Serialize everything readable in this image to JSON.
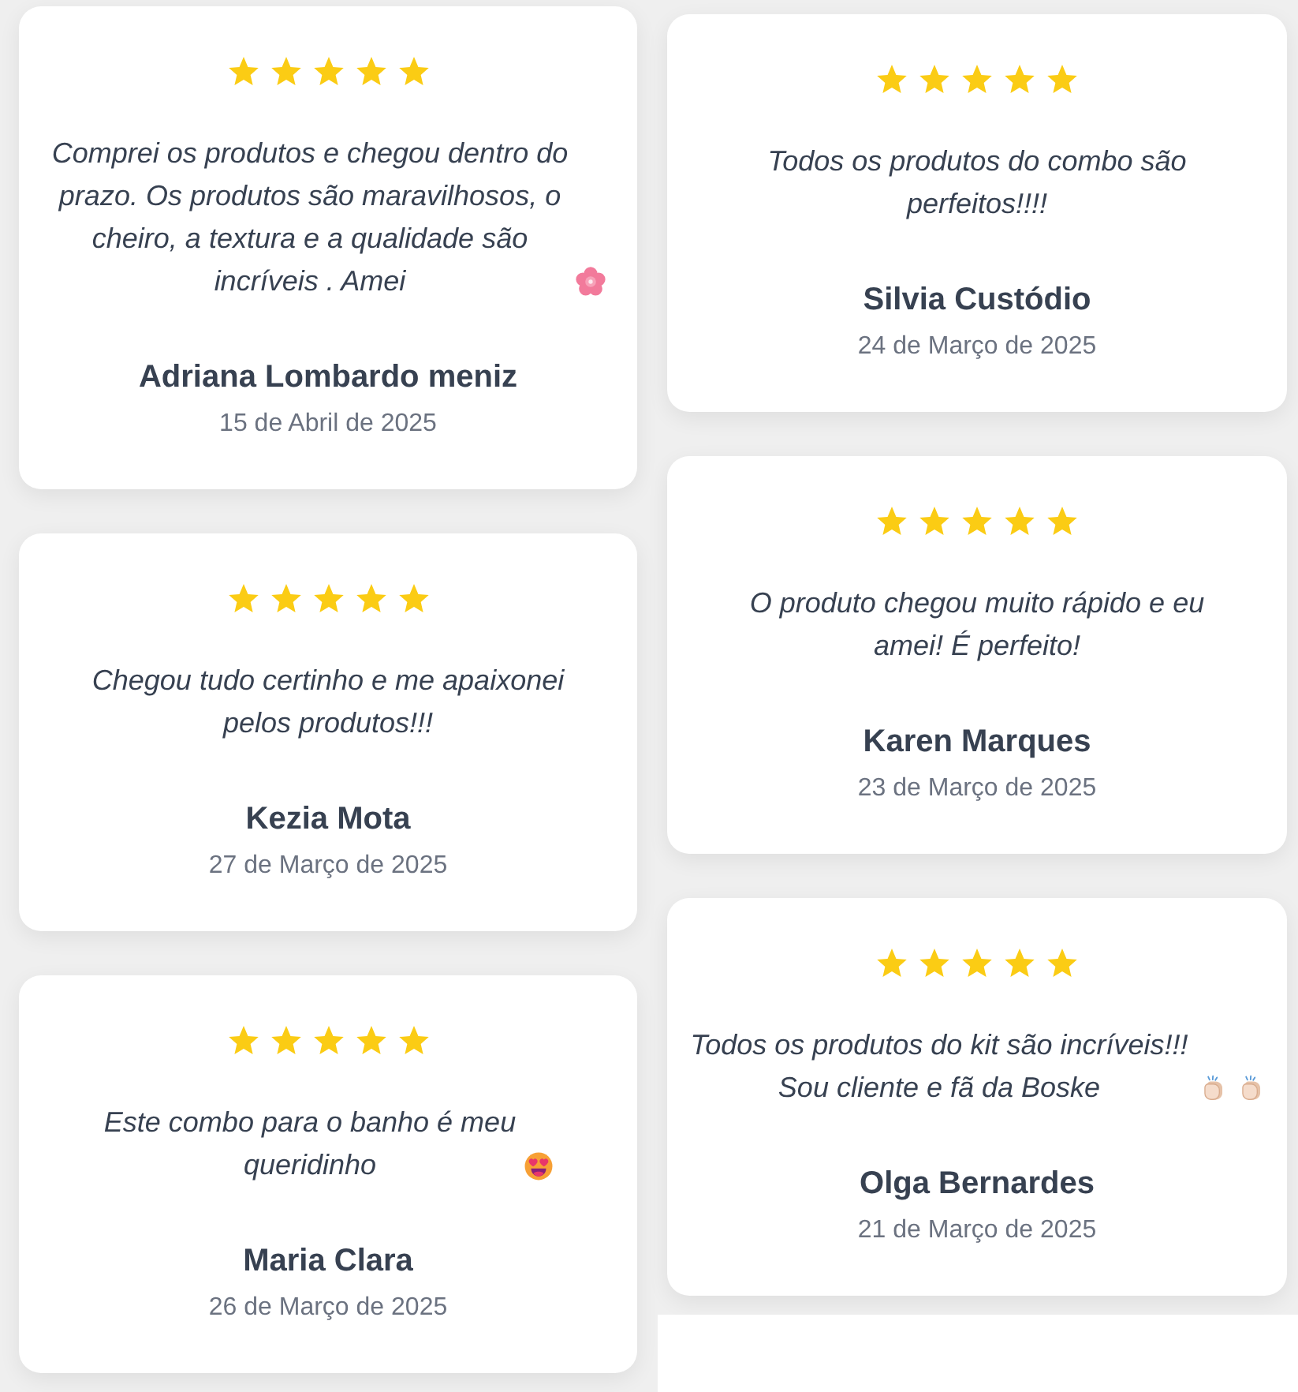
{
  "columns": [
    {
      "reviews": [
        {
          "stars": 5,
          "text": "Comprei os produtos e chegou dentro do prazo. Os produtos são maravilhosos, o cheiro, a textura e a qualidade são incríveis . Amei",
          "icons": [
            {
              "kind": "flower"
            }
          ],
          "name": "Adriana Lombardo meniz",
          "date": "15 de Abril de 2025"
        },
        {
          "stars": 5,
          "text": "Chegou tudo certinho e me apaixonei pelos produtos!!!",
          "name": "Kezia Mota",
          "date": "27 de Março de 2025"
        },
        {
          "stars": 5,
          "text": "Este combo para o banho é meu queridinho",
          "icons": [
            {
              "kind": "heart_eyes"
            }
          ],
          "name": "Maria Clara",
          "date": "26 de Março de 2025"
        }
      ]
    },
    {
      "reviews": [
        {
          "stars": 5,
          "text": "Todos os produtos do combo são perfeitos!!!!",
          "name": "Silvia Custódio",
          "date": "24 de Março de 2025"
        },
        {
          "stars": 5,
          "text": "O produto chegou muito rápido e eu amei! É perfeito!",
          "name": "Karen Marques",
          "date": "23 de Março de 2025"
        },
        {
          "stars": 5,
          "text": "Todos os produtos do kit são incríveis!!! Sou cliente e fã da Boske",
          "icons": [
            {
              "kind": "clap"
            },
            {
              "kind": "clap"
            }
          ],
          "name": "Olga Bernardes",
          "date": "21 de Março de 2025"
        }
      ]
    }
  ]
}
